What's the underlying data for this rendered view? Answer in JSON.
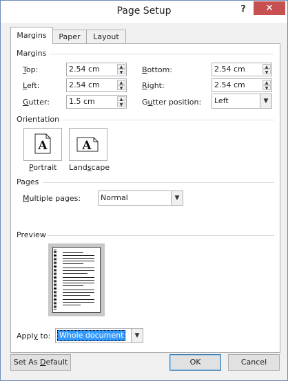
{
  "window": {
    "title": "Page Setup",
    "help": "?",
    "close": "✕"
  },
  "tabs": [
    {
      "label": "Margins"
    },
    {
      "label": "Paper"
    },
    {
      "label": "Layout"
    }
  ],
  "margins": {
    "heading": "Margins",
    "top": {
      "label_u": "T",
      "label_rest": "op:",
      "value": "2.54 cm"
    },
    "bottom": {
      "label_u": "B",
      "label_rest": "ottom:",
      "value": "2.54 cm"
    },
    "left": {
      "label_u": "L",
      "label_rest": "eft:",
      "value": "2.54 cm"
    },
    "right": {
      "label_u": "R",
      "label_rest": "ight:",
      "value": "2.54 cm"
    },
    "gutter": {
      "label_pre": "",
      "label_u": "G",
      "label_rest": "utter:",
      "value": "1.5 cm"
    },
    "gutter_position": {
      "label_pre": "G",
      "label_u": "u",
      "label_rest": "tter position:",
      "value": "Left"
    }
  },
  "orientation": {
    "heading": "Orientation",
    "portrait": {
      "label_u": "P",
      "label_rest": "ortrait",
      "glyph": "A"
    },
    "landscape": {
      "label_pre": "Land",
      "label_u": "s",
      "label_rest": "cape",
      "glyph": "A"
    }
  },
  "pages": {
    "heading": "Pages",
    "multiple": {
      "label_u": "M",
      "label_rest": "ultiple pages:",
      "value": "Normal"
    }
  },
  "preview": {
    "heading": "Preview"
  },
  "apply": {
    "label_pre": "Appl",
    "label_u": "y",
    "label_rest": " to:",
    "value": "Whole document"
  },
  "footer": {
    "set_default_pre": "Set As ",
    "set_default_u": "D",
    "set_default_rest": "efault",
    "ok": "OK",
    "cancel": "Cancel"
  }
}
